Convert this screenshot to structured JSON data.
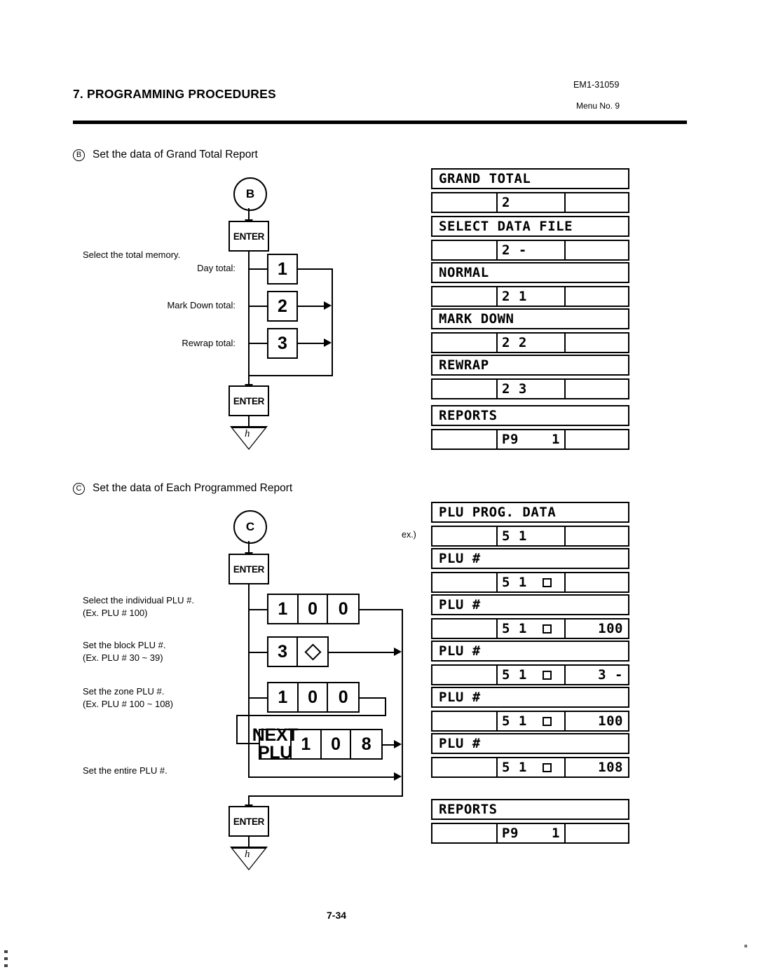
{
  "header": {
    "title": "7. PROGRAMMING PROCEDURES",
    "doc_code": "EM1-31059",
    "menu_no": "Menu No. 9"
  },
  "footer": {
    "page_number": "7-34"
  },
  "sections": [
    {
      "marker": "B",
      "heading": "Set the data of Grand Total Report",
      "start_node": "B",
      "enter_label": "ENTER",
      "terminator": "h",
      "intro_note": "Select the total memory.",
      "options": [
        {
          "label": "Day total:",
          "key": "1"
        },
        {
          "label": "Mark Down total:",
          "key": "2"
        },
        {
          "label": "Rewrap total:",
          "key": "3"
        }
      ],
      "displays": [
        {
          "title": "GRAND TOTAL",
          "left": "",
          "mid": "2",
          "box": false,
          "right": ""
        },
        {
          "title": "SELECT DATA FILE",
          "left": "",
          "mid": "2 -",
          "box": false,
          "right": ""
        },
        {
          "title": "NORMAL",
          "left": "",
          "mid": "2 1",
          "box": false,
          "right": ""
        },
        {
          "title": "MARK DOWN",
          "left": "",
          "mid": "2 2",
          "box": false,
          "right": ""
        },
        {
          "title": "REWRAP",
          "left": "",
          "mid": "2 3",
          "box": false,
          "right": ""
        }
      ],
      "final_display": {
        "title": "REPORTS",
        "left": "",
        "mid": "P9",
        "right_in_mid": "1",
        "box": false,
        "right": ""
      }
    },
    {
      "marker": "C",
      "heading": "Set the data of Each Programmed Report",
      "start_node": "C",
      "enter_label": "ENTER",
      "terminator": "h",
      "ex_label": "ex.)",
      "next_plu_label": "NEXT\nPLU",
      "options": [
        {
          "label": "Select the individual PLU #.\n(Ex. PLU # 100)",
          "keys": [
            "1",
            "0",
            "0"
          ]
        },
        {
          "label": "Set the block PLU #.\n(Ex. PLU # 30 ~ 39)",
          "keys": [
            "3",
            "diamond"
          ]
        },
        {
          "label": "Set the zone PLU #.\n(Ex. PLU # 100 ~ 108)",
          "keys": [
            "1",
            "0",
            "0"
          ]
        },
        {
          "label": "",
          "keys": [
            "NEXT PLU",
            "1",
            "0",
            "8"
          ]
        },
        {
          "label": "Set the entire PLU #.",
          "keys": []
        }
      ],
      "displays": [
        {
          "title": "PLU PROG. DATA",
          "left": "",
          "mid": "5 1",
          "box": false,
          "right": ""
        },
        {
          "title": "PLU #",
          "left": "",
          "mid": "5 1",
          "box": true,
          "right": ""
        },
        {
          "title": "PLU #",
          "left": "",
          "mid": "5 1",
          "box": true,
          "right": "100"
        },
        {
          "title": "PLU #",
          "left": "",
          "mid": "5 1",
          "box": true,
          "right": "3 -"
        },
        {
          "title": "PLU #",
          "left": "",
          "mid": "5 1",
          "box": true,
          "right": "100"
        },
        {
          "title": "PLU #",
          "left": "",
          "mid": "5 1",
          "box": true,
          "right": "108"
        }
      ],
      "final_display": {
        "title": "REPORTS",
        "left": "",
        "mid": "P9",
        "right_in_mid": "1",
        "box": false,
        "right": ""
      }
    }
  ]
}
